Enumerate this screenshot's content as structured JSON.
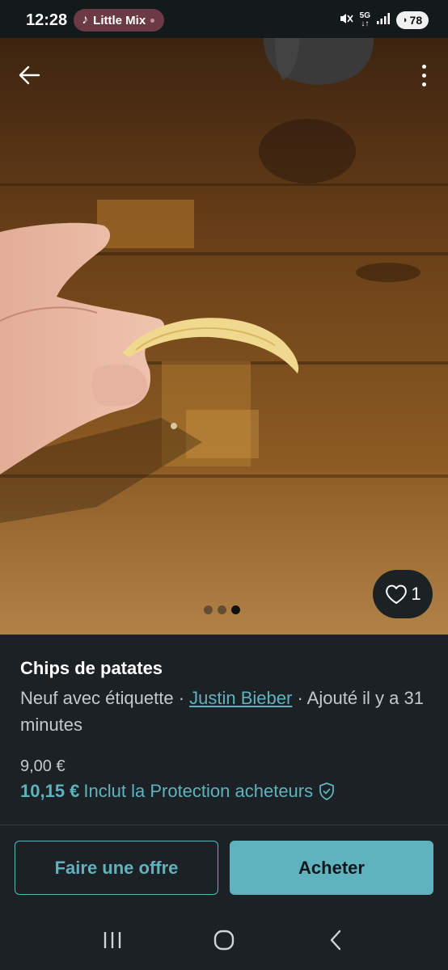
{
  "status_bar": {
    "time": "12:28",
    "media_title": "Little Mix",
    "network_top": "5G",
    "battery": "78"
  },
  "listing": {
    "title": "Chips de patates",
    "condition": "Neuf avec étiquette",
    "separator": " · ",
    "seller": "Justin Bieber",
    "posted": "Ajouté il y a 31 minutes",
    "price": "9,00 €",
    "price_total": "10,15 €",
    "protection_text": "Inclut la Protection acheteurs"
  },
  "gallery": {
    "likes": "1",
    "image_count": 3,
    "active_index": 2
  },
  "actions": {
    "offer_label": "Faire une offre",
    "buy_label": "Acheter"
  },
  "colors": {
    "accent": "#5fb3bf",
    "background": "#1b2124"
  }
}
